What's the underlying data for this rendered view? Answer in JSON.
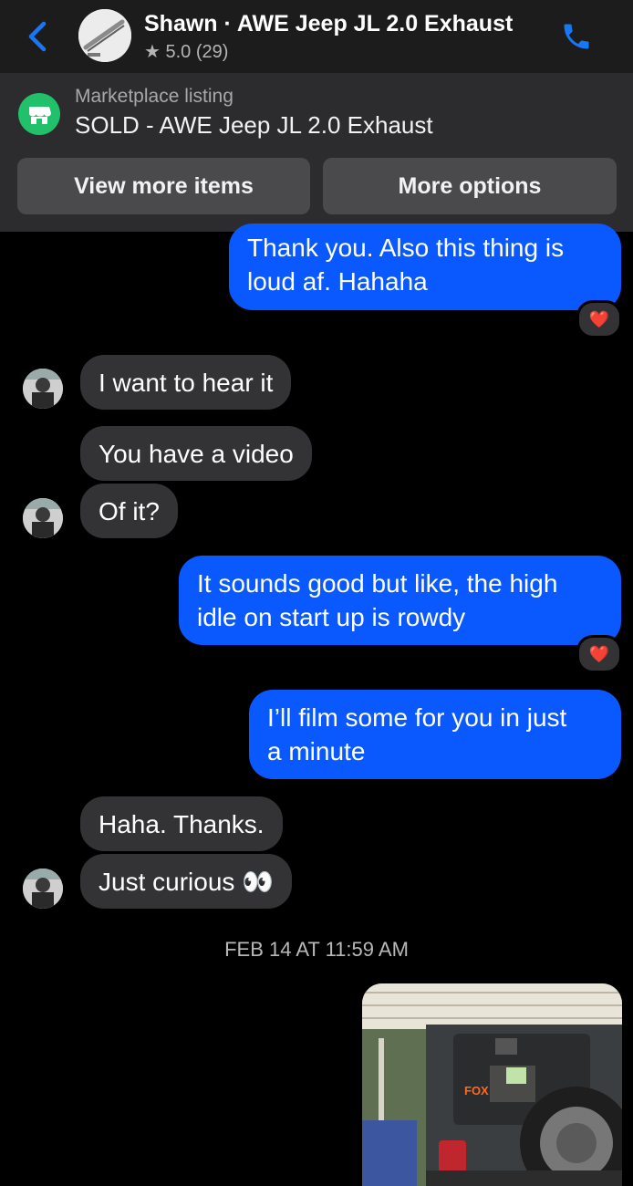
{
  "header": {
    "title": "Shawn · AWE Jeep JL 2.0 Exhaust",
    "rating": "★ 5.0 (29)",
    "accent": "#1877f2"
  },
  "listing": {
    "label": "Marketplace listing",
    "title": "SOLD - AWE Jeep JL 2.0 Exhaust",
    "view_more": "View more items",
    "more_options": "More options"
  },
  "messages": [
    {
      "from": "me",
      "text1": "Thank you. Also this thing is",
      "text2": "loud af. Hahaha",
      "reaction": "❤️"
    },
    {
      "from": "them",
      "text": "I want to hear it"
    },
    {
      "from": "them",
      "text": "You have a video"
    },
    {
      "from": "them",
      "text": "Of it?"
    },
    {
      "from": "me",
      "text1": "It sounds good but like, the high",
      "text2": "idle on start up is rowdy",
      "reaction": "❤️"
    },
    {
      "from": "me",
      "text1": "I’ll film some for you in just",
      "text2": "a minute"
    },
    {
      "from": "them",
      "text": "Haha. Thanks."
    },
    {
      "from": "them",
      "text": "Just curious 👀"
    }
  ],
  "timestamp": "FEB 14 AT 11:59 AM",
  "photo": {
    "decal_text": "FOX"
  },
  "colors": {
    "outgoing": "#0a59ff",
    "incoming": "#333336",
    "marketplace": "#21c16b"
  }
}
